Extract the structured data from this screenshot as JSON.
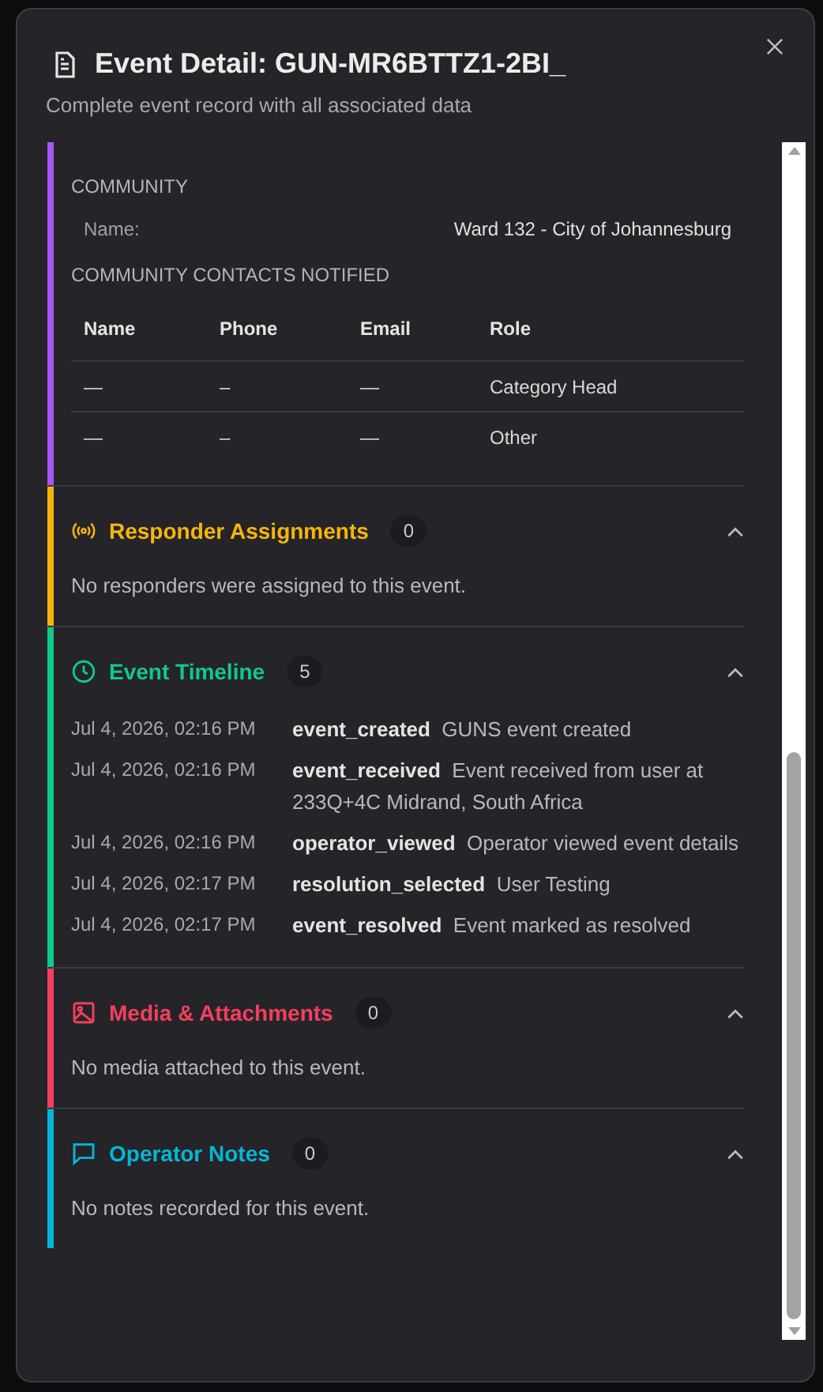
{
  "dialog": {
    "title": "Event Detail: GUN-MR6BTTZ1-2BI_",
    "subtitle": "Complete event record with all associated data"
  },
  "sections": [
    {
      "kind": "community",
      "color": "#a855f7",
      "community_heading": "COMMUNITY",
      "fields": [
        {
          "label": "Name:",
          "value": "Ward 132 - City of Johannesburg"
        }
      ],
      "contacts_heading": "COMMUNITY CONTACTS NOTIFIED",
      "contacts_table": {
        "columns": [
          "Name",
          "Phone",
          "Email",
          "Role"
        ],
        "rows": [
          [
            "—",
            "–",
            "—",
            "Category Head"
          ],
          [
            "—",
            "–",
            "—",
            "Other"
          ]
        ]
      }
    },
    {
      "kind": "empty",
      "title": "Responder Assignments",
      "count": "0",
      "color": "#f5b50b",
      "expanded": true,
      "message": "No responders were assigned to this event."
    },
    {
      "kind": "timeline",
      "title": "Event Timeline",
      "count": "5",
      "color": "#10c98a",
      "expanded": true,
      "entries": [
        {
          "time": "Jul 4, 2026, 02:16 PM",
          "type": "event_created",
          "description": "GUNS event created"
        },
        {
          "time": "Jul 4, 2026, 02:16 PM",
          "type": "event_received",
          "description": "Event received from user at 233Q+4C Midrand, South Africa"
        },
        {
          "time": "Jul 4, 2026, 02:16 PM",
          "type": "operator_viewed",
          "description": "Operator viewed event details"
        },
        {
          "time": "Jul 4, 2026, 02:17 PM",
          "type": "resolution_selected",
          "description": "User Testing"
        },
        {
          "time": "Jul 4, 2026, 02:17 PM",
          "type": "event_resolved",
          "description": "Event marked as resolved"
        }
      ]
    },
    {
      "kind": "empty",
      "title": "Media & Attachments",
      "count": "0",
      "color": "#f43f5e",
      "expanded": true,
      "message": "No media attached to this event."
    },
    {
      "kind": "empty",
      "title": "Operator Notes",
      "count": "0",
      "color": "#06b6d4",
      "expanded": true,
      "message": "No notes recorded for this event."
    }
  ]
}
